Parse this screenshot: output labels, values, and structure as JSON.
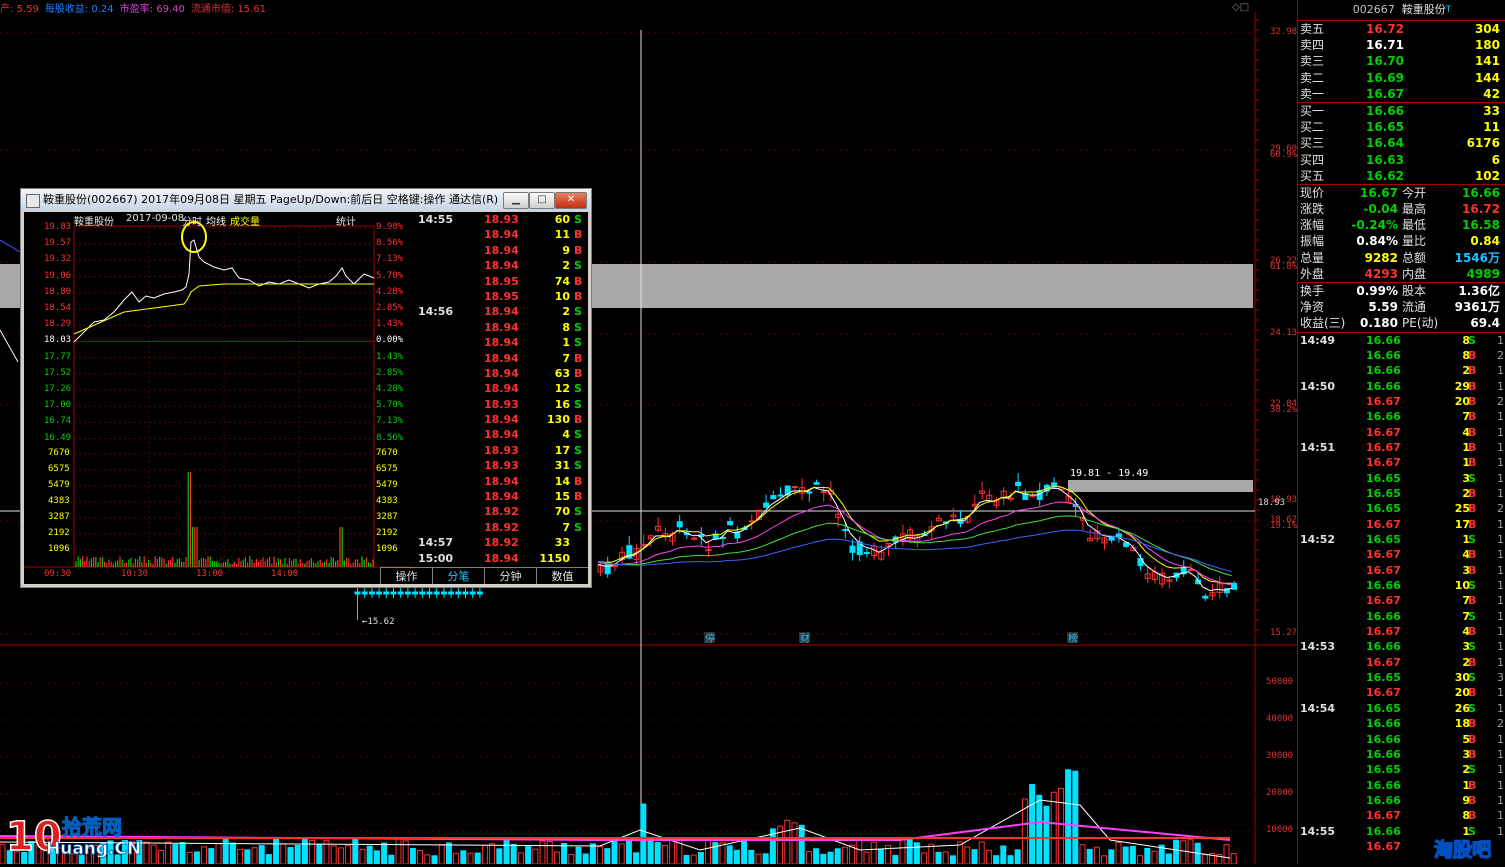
{
  "info_line": [
    {
      "text": "产: 5.59",
      "color": "#e03030"
    },
    {
      "text": "每股收益: 0.24",
      "color": "#2080ff"
    },
    {
      "text": "市盈率: 69.40",
      "color": "#d040d0"
    },
    {
      "text": "流通市值: 15.61",
      "color": "#e03030"
    }
  ],
  "price_axis": [
    "32.98",
    "29.60",
    "26.22",
    "24.13",
    "22.04",
    "18.93",
    "18.62",
    "15.27"
  ],
  "price_axis_minor": [
    "60.9%",
    "61.8%",
    "38.2%",
    "19.1%"
  ],
  "volume_axis": [
    "50000",
    "40000",
    "30000",
    "20000",
    "10000"
  ],
  "chart_annotations": {
    "low_marker": "15.62",
    "range_label": "19.81 - 19.49",
    "event_labels": [
      "停",
      "财",
      "榜"
    ],
    "price_line_label": "18.93"
  },
  "right_panel": {
    "code": "002667",
    "name": "鞍重股份",
    "sell_orders": [
      {
        "label": "卖五",
        "price": "16.72",
        "vol": "304",
        "pc": "red"
      },
      {
        "label": "卖四",
        "price": "16.71",
        "vol": "180",
        "pc": "white"
      },
      {
        "label": "卖三",
        "price": "16.70",
        "vol": "141",
        "pc": "green"
      },
      {
        "label": "卖二",
        "price": "16.69",
        "vol": "144",
        "pc": "green"
      },
      {
        "label": "卖一",
        "price": "16.67",
        "vol": "42",
        "pc": "green"
      }
    ],
    "buy_orders": [
      {
        "label": "买一",
        "price": "16.66",
        "vol": "33",
        "pc": "green"
      },
      {
        "label": "买二",
        "price": "16.65",
        "vol": "11",
        "pc": "green"
      },
      {
        "label": "买三",
        "price": "16.64",
        "vol": "6176",
        "pc": "green"
      },
      {
        "label": "买四",
        "price": "16.63",
        "vol": "6",
        "pc": "green"
      },
      {
        "label": "买五",
        "price": "16.62",
        "vol": "102",
        "pc": "green"
      }
    ],
    "stats": [
      {
        "l1": "现价",
        "v1": "16.67",
        "c1": "green",
        "l2": "今开",
        "v2": "16.66",
        "c2": "green"
      },
      {
        "l1": "涨跌",
        "v1": "-0.04",
        "c1": "green",
        "l2": "最高",
        "v2": "16.72",
        "c2": "red"
      },
      {
        "l1": "涨幅",
        "v1": "-0.24%",
        "c1": "green",
        "l2": "最低",
        "v2": "16.58",
        "c2": "green"
      },
      {
        "l1": "振幅",
        "v1": "0.84%",
        "c1": "white",
        "l2": "量比",
        "v2": "0.84",
        "c2": "yellow"
      },
      {
        "l1": "总量",
        "v1": "9282",
        "c1": "yellow",
        "l2": "总额",
        "v2": "1546万",
        "c2": "cyan"
      },
      {
        "l1": "外盘",
        "v1": "4293",
        "c1": "red",
        "l2": "内盘",
        "v2": "4989",
        "c2": "green"
      }
    ],
    "stats2": [
      {
        "l1": "换手",
        "v1": "0.99%",
        "c1": "white",
        "l2": "股本",
        "v2": "1.36亿",
        "c2": "white"
      },
      {
        "l1": "净资",
        "v1": "5.59",
        "c1": "white",
        "l2": "流通",
        "v2": "9361万",
        "c2": "white"
      },
      {
        "l1": "收益(三)",
        "v1": "0.180",
        "c1": "white",
        "l2": "PE(动)",
        "v2": "69.4",
        "c2": "white"
      }
    ],
    "ticks": [
      {
        "t": "14:49",
        "p": "16.66",
        "v": "8",
        "d": "S",
        "n": "1"
      },
      {
        "t": "",
        "p": "16.66",
        "v": "8",
        "d": "B",
        "n": "2"
      },
      {
        "t": "",
        "p": "16.66",
        "v": "2",
        "d": "B",
        "n": "1"
      },
      {
        "t": "14:50",
        "p": "16.66",
        "v": "29",
        "d": "B",
        "n": "1"
      },
      {
        "t": "",
        "p": "16.67",
        "v": "20",
        "d": "B",
        "n": "2"
      },
      {
        "t": "",
        "p": "16.66",
        "v": "7",
        "d": "B",
        "n": "1"
      },
      {
        "t": "",
        "p": "16.67",
        "v": "4",
        "d": "B",
        "n": "1"
      },
      {
        "t": "14:51",
        "p": "16.67",
        "v": "1",
        "d": "B",
        "n": "1"
      },
      {
        "t": "",
        "p": "16.67",
        "v": "1",
        "d": "B",
        "n": "1"
      },
      {
        "t": "",
        "p": "16.65",
        "v": "3",
        "d": "S",
        "n": "1"
      },
      {
        "t": "",
        "p": "16.65",
        "v": "2",
        "d": "B",
        "n": "1"
      },
      {
        "t": "",
        "p": "16.65",
        "v": "25",
        "d": "B",
        "n": "2"
      },
      {
        "t": "",
        "p": "16.67",
        "v": "17",
        "d": "B",
        "n": "1"
      },
      {
        "t": "14:52",
        "p": "16.65",
        "v": "1",
        "d": "S",
        "n": "1"
      },
      {
        "t": "",
        "p": "16.67",
        "v": "4",
        "d": "B",
        "n": "1"
      },
      {
        "t": "",
        "p": "16.67",
        "v": "3",
        "d": "B",
        "n": "1"
      },
      {
        "t": "",
        "p": "16.66",
        "v": "10",
        "d": "S",
        "n": "1"
      },
      {
        "t": "",
        "p": "16.67",
        "v": "7",
        "d": "B",
        "n": "1"
      },
      {
        "t": "",
        "p": "16.66",
        "v": "7",
        "d": "S",
        "n": "1"
      },
      {
        "t": "",
        "p": "16.67",
        "v": "4",
        "d": "B",
        "n": "1"
      },
      {
        "t": "14:53",
        "p": "16.66",
        "v": "3",
        "d": "S",
        "n": "1"
      },
      {
        "t": "",
        "p": "16.67",
        "v": "2",
        "d": "B",
        "n": "1"
      },
      {
        "t": "",
        "p": "16.65",
        "v": "30",
        "d": "S",
        "n": "3"
      },
      {
        "t": "",
        "p": "16.67",
        "v": "20",
        "d": "B",
        "n": "1"
      },
      {
        "t": "14:54",
        "p": "16.65",
        "v": "26",
        "d": "S",
        "n": "1"
      },
      {
        "t": "",
        "p": "16.66",
        "v": "18",
        "d": "B",
        "n": "2"
      },
      {
        "t": "",
        "p": "16.66",
        "v": "5",
        "d": "B",
        "n": "1"
      },
      {
        "t": "",
        "p": "16.66",
        "v": "3",
        "d": "B",
        "n": "1"
      },
      {
        "t": "",
        "p": "16.65",
        "v": "2",
        "d": "S",
        "n": "1"
      },
      {
        "t": "",
        "p": "16.66",
        "v": "1",
        "d": "B",
        "n": "1"
      },
      {
        "t": "",
        "p": "16.66",
        "v": "9",
        "d": "B",
        "n": "1"
      },
      {
        "t": "",
        "p": "16.67",
        "v": "8",
        "d": "B",
        "n": "1"
      },
      {
        "t": "14:55",
        "p": "16.66",
        "v": "1",
        "d": "S",
        "n": "1"
      },
      {
        "t": "",
        "p": "16.67",
        "v": "",
        "d": "",
        "n": ""
      }
    ]
  },
  "popup": {
    "title": "鞍重股份(002667) 2017年09月08日 星期五 PageUp/Down:前后日 空格键:操作 通达信(R)",
    "header": {
      "name": "鞍重股份",
      "date": "2017-09-08",
      "mode": "分时",
      "avg": "均线",
      "vol": "成交量",
      "stat": "统计"
    },
    "price_labels": [
      "19.83",
      "19.57",
      "19.32",
      "19.06",
      "18.80",
      "18.54",
      "18.29",
      "18.03",
      "17.77",
      "17.52",
      "17.26",
      "17.00",
      "16.74",
      "16.49"
    ],
    "pct_labels": [
      "9.98%",
      "8.56%",
      "7.13%",
      "5.70%",
      "4.28%",
      "2.85%",
      "1.43%",
      "0.00%",
      "1.43%",
      "2.85%",
      "4.28%",
      "5.70%",
      "7.13%",
      "8.56%"
    ],
    "vol_labels": [
      "7670",
      "6575",
      "5479",
      "4383",
      "3287",
      "2192",
      "1096"
    ],
    "time_labels": [
      "09:30",
      "10:30",
      "13:00",
      "14:00"
    ],
    "ticks": [
      {
        "t": "14:55",
        "p": "18.93",
        "v": "60",
        "d": "S"
      },
      {
        "t": "",
        "p": "18.94",
        "v": "11",
        "d": "B"
      },
      {
        "t": "",
        "p": "18.94",
        "v": "9",
        "d": "B"
      },
      {
        "t": "",
        "p": "18.94",
        "v": "2",
        "d": "S"
      },
      {
        "t": "",
        "p": "18.95",
        "v": "74",
        "d": "B"
      },
      {
        "t": "",
        "p": "18.95",
        "v": "10",
        "d": "B"
      },
      {
        "t": "14:56",
        "p": "18.94",
        "v": "2",
        "d": "S"
      },
      {
        "t": "",
        "p": "18.94",
        "v": "8",
        "d": "S"
      },
      {
        "t": "",
        "p": "18.94",
        "v": "1",
        "d": "S"
      },
      {
        "t": "",
        "p": "18.94",
        "v": "7",
        "d": "B"
      },
      {
        "t": "",
        "p": "18.94",
        "v": "63",
        "d": "B"
      },
      {
        "t": "",
        "p": "18.94",
        "v": "12",
        "d": "S"
      },
      {
        "t": "",
        "p": "18.93",
        "v": "16",
        "d": "S"
      },
      {
        "t": "",
        "p": "18.94",
        "v": "130",
        "d": "B"
      },
      {
        "t": "",
        "p": "18.94",
        "v": "4",
        "d": "S"
      },
      {
        "t": "",
        "p": "18.93",
        "v": "17",
        "d": "S"
      },
      {
        "t": "",
        "p": "18.93",
        "v": "31",
        "d": "S"
      },
      {
        "t": "",
        "p": "18.94",
        "v": "14",
        "d": "B"
      },
      {
        "t": "",
        "p": "18.94",
        "v": "15",
        "d": "B"
      },
      {
        "t": "",
        "p": "18.92",
        "v": "70",
        "d": "S"
      },
      {
        "t": "",
        "p": "18.92",
        "v": "7",
        "d": "S"
      },
      {
        "t": "14:57",
        "p": "18.92",
        "v": "33",
        "d": ""
      },
      {
        "t": "15:00",
        "p": "18.94",
        "v": "1150",
        "d": ""
      }
    ],
    "tabs": [
      "操作",
      "分笔",
      "分钟",
      "数值"
    ]
  },
  "watermarks": {
    "left_main": "拾荒网",
    "left_sub": "Huang.CN",
    "right": "淘股吧"
  }
}
